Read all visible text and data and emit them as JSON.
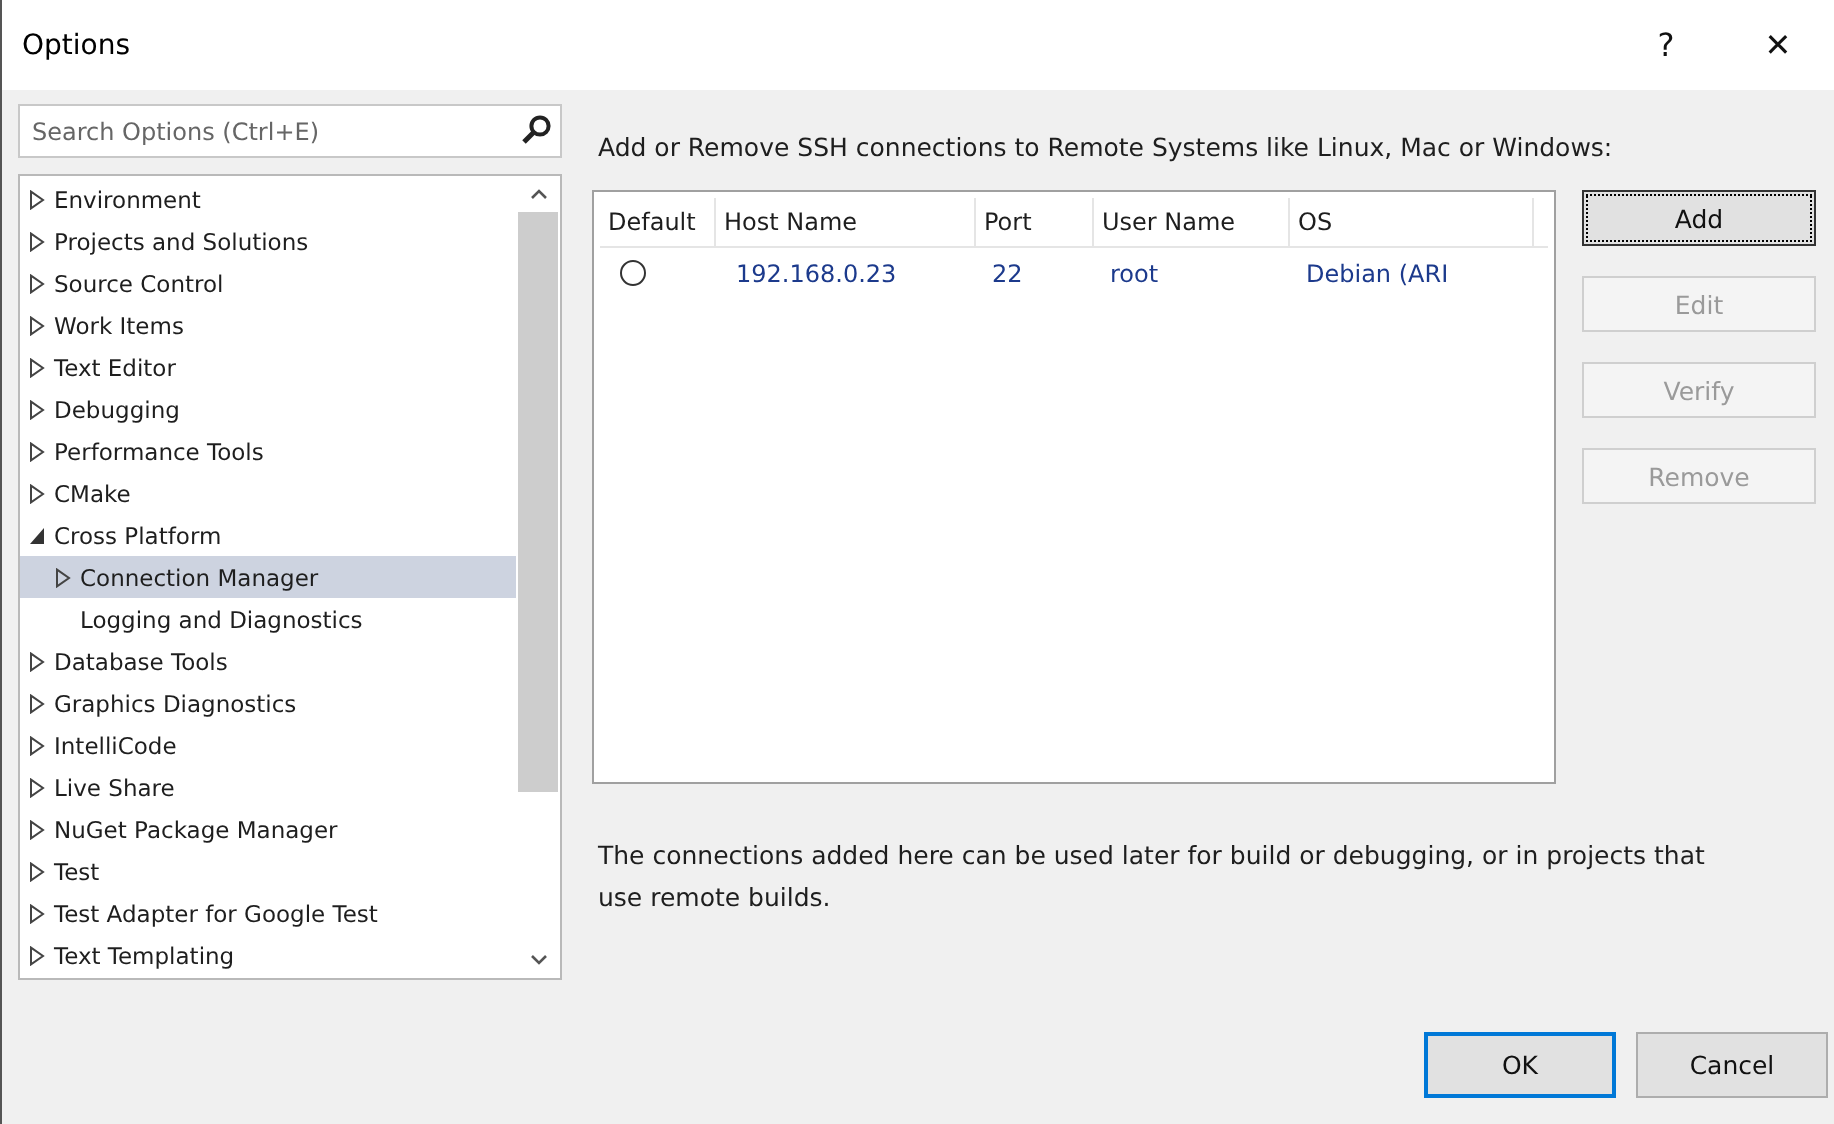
{
  "window": {
    "title": "Options",
    "help": "?",
    "close": "✕"
  },
  "search": {
    "placeholder": "Search Options (Ctrl+E)"
  },
  "tree": [
    {
      "label": "Environment",
      "kind": "node",
      "expanded": false,
      "selected": false
    },
    {
      "label": "Projects and Solutions",
      "kind": "node",
      "expanded": false,
      "selected": false
    },
    {
      "label": "Source Control",
      "kind": "node",
      "expanded": false,
      "selected": false
    },
    {
      "label": "Work Items",
      "kind": "node",
      "expanded": false,
      "selected": false
    },
    {
      "label": "Text Editor",
      "kind": "node",
      "expanded": false,
      "selected": false
    },
    {
      "label": "Debugging",
      "kind": "node",
      "expanded": false,
      "selected": false
    },
    {
      "label": "Performance Tools",
      "kind": "node",
      "expanded": false,
      "selected": false
    },
    {
      "label": "CMake",
      "kind": "node",
      "expanded": false,
      "selected": false
    },
    {
      "label": "Cross Platform",
      "kind": "node",
      "expanded": true,
      "selected": false,
      "children": [
        {
          "label": "Connection Manager",
          "kind": "node",
          "expanded": false,
          "selected": true
        },
        {
          "label": "Logging and Diagnostics",
          "kind": "leaf",
          "selected": false
        }
      ]
    },
    {
      "label": "Database Tools",
      "kind": "node",
      "expanded": false,
      "selected": false
    },
    {
      "label": "Graphics Diagnostics",
      "kind": "node",
      "expanded": false,
      "selected": false
    },
    {
      "label": "IntelliCode",
      "kind": "node",
      "expanded": false,
      "selected": false
    },
    {
      "label": "Live Share",
      "kind": "node",
      "expanded": false,
      "selected": false
    },
    {
      "label": "NuGet Package Manager",
      "kind": "node",
      "expanded": false,
      "selected": false
    },
    {
      "label": "Test",
      "kind": "node",
      "expanded": false,
      "selected": false
    },
    {
      "label": "Test Adapter for Google Test",
      "kind": "node",
      "expanded": false,
      "selected": false
    },
    {
      "label": "Text Templating",
      "kind": "node",
      "expanded": false,
      "selected": false
    }
  ],
  "intro": "Add or Remove SSH connections to Remote Systems like Linux, Mac or Windows:",
  "table": {
    "columns": [
      "Default",
      "Host Name",
      "Port",
      "User Name",
      "OS"
    ],
    "rows": [
      {
        "default": false,
        "host": "192.168.0.23",
        "port": "22",
        "user": "root",
        "os": "Debian (ARI"
      }
    ]
  },
  "side_buttons": [
    {
      "label": "Add",
      "disabled": false,
      "focused": true
    },
    {
      "label": "Edit",
      "disabled": true,
      "focused": false
    },
    {
      "label": "Verify",
      "disabled": true,
      "focused": false
    },
    {
      "label": "Remove",
      "disabled": true,
      "focused": false
    }
  ],
  "note": "The connections added here can be used later for build or debugging, or in projects that use remote builds.",
  "buttons": [
    {
      "label": "OK",
      "kind": "primary"
    },
    {
      "label": "Cancel",
      "kind": "normal"
    }
  ]
}
